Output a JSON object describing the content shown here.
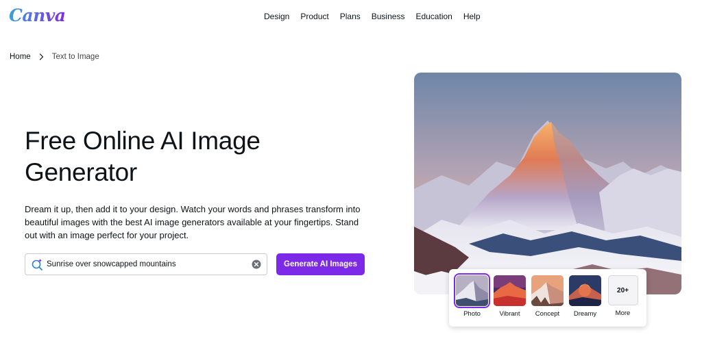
{
  "header": {
    "logo": "Canva",
    "nav": [
      "Design",
      "Product",
      "Plans",
      "Business",
      "Education",
      "Help"
    ]
  },
  "breadcrumb": {
    "home": "Home",
    "current": "Text to Image"
  },
  "hero": {
    "title": "Free Online AI Image Generator",
    "description": "Dream it up, then add it to your design. Watch your words and phrases transform into beautiful images with the best AI image generators available at your fingertips. Stand out with an image perfect for your project.",
    "search_value": "Sunrise over snowcapped mountains",
    "button": "Generate AI Images"
  },
  "styles": {
    "selected": "Photo",
    "options": [
      {
        "label": "Photo"
      },
      {
        "label": "Vibrant"
      },
      {
        "label": "Concept"
      },
      {
        "label": "Dreamy"
      },
      {
        "label": "More",
        "badge": "20+"
      }
    ]
  },
  "colors": {
    "accent": "#7d2ae8",
    "text": "#0e1318",
    "logo_start": "#3fa0d8",
    "logo_end": "#7d2ae8"
  }
}
